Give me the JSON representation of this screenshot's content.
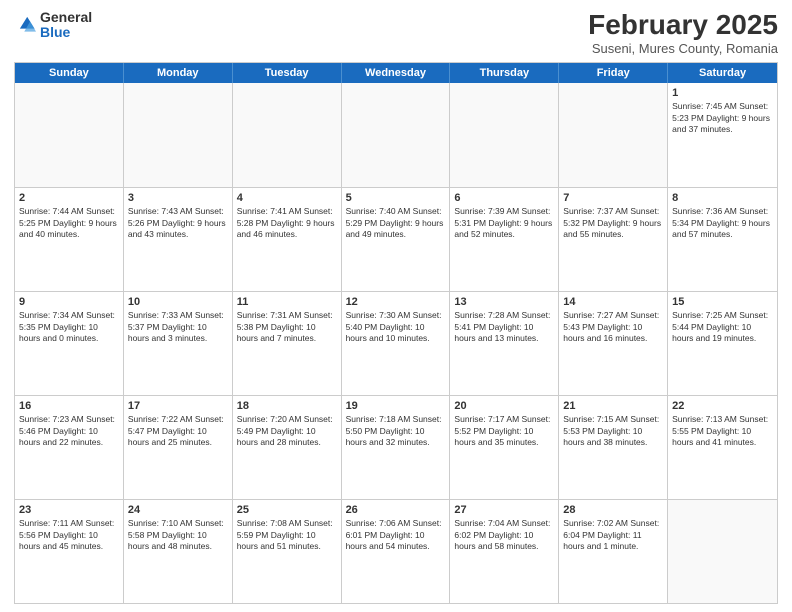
{
  "logo": {
    "general": "General",
    "blue": "Blue"
  },
  "title": "February 2025",
  "location": "Suseni, Mures County, Romania",
  "header_days": [
    "Sunday",
    "Monday",
    "Tuesday",
    "Wednesday",
    "Thursday",
    "Friday",
    "Saturday"
  ],
  "weeks": [
    [
      {
        "day": "",
        "info": ""
      },
      {
        "day": "",
        "info": ""
      },
      {
        "day": "",
        "info": ""
      },
      {
        "day": "",
        "info": ""
      },
      {
        "day": "",
        "info": ""
      },
      {
        "day": "",
        "info": ""
      },
      {
        "day": "1",
        "info": "Sunrise: 7:45 AM\nSunset: 5:23 PM\nDaylight: 9 hours and 37 minutes."
      }
    ],
    [
      {
        "day": "2",
        "info": "Sunrise: 7:44 AM\nSunset: 5:25 PM\nDaylight: 9 hours and 40 minutes."
      },
      {
        "day": "3",
        "info": "Sunrise: 7:43 AM\nSunset: 5:26 PM\nDaylight: 9 hours and 43 minutes."
      },
      {
        "day": "4",
        "info": "Sunrise: 7:41 AM\nSunset: 5:28 PM\nDaylight: 9 hours and 46 minutes."
      },
      {
        "day": "5",
        "info": "Sunrise: 7:40 AM\nSunset: 5:29 PM\nDaylight: 9 hours and 49 minutes."
      },
      {
        "day": "6",
        "info": "Sunrise: 7:39 AM\nSunset: 5:31 PM\nDaylight: 9 hours and 52 minutes."
      },
      {
        "day": "7",
        "info": "Sunrise: 7:37 AM\nSunset: 5:32 PM\nDaylight: 9 hours and 55 minutes."
      },
      {
        "day": "8",
        "info": "Sunrise: 7:36 AM\nSunset: 5:34 PM\nDaylight: 9 hours and 57 minutes."
      }
    ],
    [
      {
        "day": "9",
        "info": "Sunrise: 7:34 AM\nSunset: 5:35 PM\nDaylight: 10 hours and 0 minutes."
      },
      {
        "day": "10",
        "info": "Sunrise: 7:33 AM\nSunset: 5:37 PM\nDaylight: 10 hours and 3 minutes."
      },
      {
        "day": "11",
        "info": "Sunrise: 7:31 AM\nSunset: 5:38 PM\nDaylight: 10 hours and 7 minutes."
      },
      {
        "day": "12",
        "info": "Sunrise: 7:30 AM\nSunset: 5:40 PM\nDaylight: 10 hours and 10 minutes."
      },
      {
        "day": "13",
        "info": "Sunrise: 7:28 AM\nSunset: 5:41 PM\nDaylight: 10 hours and 13 minutes."
      },
      {
        "day": "14",
        "info": "Sunrise: 7:27 AM\nSunset: 5:43 PM\nDaylight: 10 hours and 16 minutes."
      },
      {
        "day": "15",
        "info": "Sunrise: 7:25 AM\nSunset: 5:44 PM\nDaylight: 10 hours and 19 minutes."
      }
    ],
    [
      {
        "day": "16",
        "info": "Sunrise: 7:23 AM\nSunset: 5:46 PM\nDaylight: 10 hours and 22 minutes."
      },
      {
        "day": "17",
        "info": "Sunrise: 7:22 AM\nSunset: 5:47 PM\nDaylight: 10 hours and 25 minutes."
      },
      {
        "day": "18",
        "info": "Sunrise: 7:20 AM\nSunset: 5:49 PM\nDaylight: 10 hours and 28 minutes."
      },
      {
        "day": "19",
        "info": "Sunrise: 7:18 AM\nSunset: 5:50 PM\nDaylight: 10 hours and 32 minutes."
      },
      {
        "day": "20",
        "info": "Sunrise: 7:17 AM\nSunset: 5:52 PM\nDaylight: 10 hours and 35 minutes."
      },
      {
        "day": "21",
        "info": "Sunrise: 7:15 AM\nSunset: 5:53 PM\nDaylight: 10 hours and 38 minutes."
      },
      {
        "day": "22",
        "info": "Sunrise: 7:13 AM\nSunset: 5:55 PM\nDaylight: 10 hours and 41 minutes."
      }
    ],
    [
      {
        "day": "23",
        "info": "Sunrise: 7:11 AM\nSunset: 5:56 PM\nDaylight: 10 hours and 45 minutes."
      },
      {
        "day": "24",
        "info": "Sunrise: 7:10 AM\nSunset: 5:58 PM\nDaylight: 10 hours and 48 minutes."
      },
      {
        "day": "25",
        "info": "Sunrise: 7:08 AM\nSunset: 5:59 PM\nDaylight: 10 hours and 51 minutes."
      },
      {
        "day": "26",
        "info": "Sunrise: 7:06 AM\nSunset: 6:01 PM\nDaylight: 10 hours and 54 minutes."
      },
      {
        "day": "27",
        "info": "Sunrise: 7:04 AM\nSunset: 6:02 PM\nDaylight: 10 hours and 58 minutes."
      },
      {
        "day": "28",
        "info": "Sunrise: 7:02 AM\nSunset: 6:04 PM\nDaylight: 11 hours and 1 minute."
      },
      {
        "day": "",
        "info": ""
      }
    ]
  ]
}
